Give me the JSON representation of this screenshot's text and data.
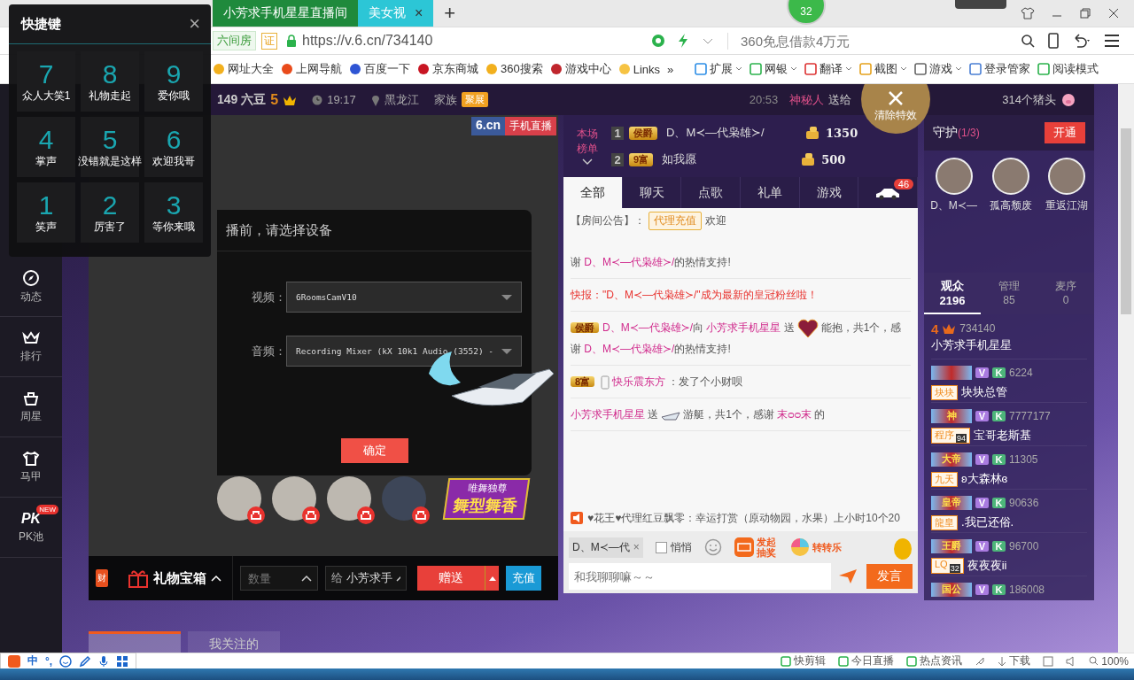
{
  "browser": {
    "tabs": [
      {
        "title": "小芳求手机星星直播间",
        "selected": false
      },
      {
        "title": "美女视",
        "selected": true
      }
    ],
    "tab_close": "×",
    "new_tab": "+",
    "badge": "32",
    "site_label": "六间房",
    "site_badge": "证",
    "url": "https://v.6.cn/734140",
    "search_placeholder": "360免息借款4万元",
    "bookmarks": [
      "网址大全",
      "上网导航",
      "百度一下",
      "京东商城",
      "360搜索",
      "游戏中心",
      "Links"
    ],
    "more": "»",
    "tools": [
      {
        "label": "扩展",
        "dropdown": true
      },
      {
        "label": "网银",
        "dropdown": true
      },
      {
        "label": "翻译",
        "dropdown": true
      },
      {
        "label": "截图",
        "dropdown": true
      },
      {
        "label": "游戏",
        "dropdown": true
      },
      {
        "label": "登录管家",
        "dropdown": false
      },
      {
        "label": "阅读模式",
        "dropdown": false
      }
    ]
  },
  "shortcuts": {
    "title": "快捷键",
    "close": "×",
    "items": [
      {
        "key": "7",
        "label": "众人大笑1"
      },
      {
        "key": "8",
        "label": "礼物走起"
      },
      {
        "key": "9",
        "label": "爱你哦"
      },
      {
        "key": "4",
        "label": "掌声"
      },
      {
        "key": "5",
        "label": "没错就是这样"
      },
      {
        "key": "6",
        "label": "欢迎我哥"
      },
      {
        "key": "1",
        "label": "笑声"
      },
      {
        "key": "2",
        "label": "厉害了"
      },
      {
        "key": "3",
        "label": "等你来哦"
      }
    ]
  },
  "sidebar": [
    {
      "kind": "compass",
      "label": "动态"
    },
    {
      "kind": "crown",
      "label": "排行"
    },
    {
      "kind": "basket",
      "label": "周星"
    },
    {
      "kind": "shirt",
      "label": "马甲"
    },
    {
      "kind": "pk",
      "mark": "PK",
      "label": "PK池",
      "badge": "NEW"
    }
  ],
  "room": {
    "beans": "149 六豆",
    "level_digit": "5",
    "time": "19:17",
    "location": "黑龙江",
    "family_label": "家族",
    "family_badge": "聚展",
    "feed_time": "20:53",
    "feed_sender": "神秘人",
    "feed_verb": "送给",
    "feed_gift": "314个猪头",
    "clear_effects": "清除特效"
  },
  "video": {
    "logo": "6.cn",
    "logo_tag": "手机直播",
    "dialog": {
      "title": "播前，请选择设备",
      "fields": [
        {
          "label": "视频：",
          "value": "6RoomsCamV10"
        },
        {
          "label": "音频：",
          "value": "Recording Mixer (kX 10k1 Audio (3552) -"
        }
      ],
      "confirm": "确定"
    },
    "seats": [
      {
        "kind": "photo"
      },
      {
        "kind": "photo"
      },
      {
        "kind": "photo"
      },
      {
        "kind": "dark"
      }
    ],
    "dance_badge": {
      "title": "舞型舞香",
      "subtitle": "唯舞独尊"
    }
  },
  "gift_bar": {
    "wealth": "财",
    "gift_box": "礼物宝箱",
    "quantity_placeholder": "数量",
    "to_label": "给",
    "to_value": "小芳求手",
    "send": "赠送",
    "recharge": "充值"
  },
  "ranking": {
    "title": "本场榜单",
    "rows": [
      {
        "rank": "1",
        "badge": "侯爵",
        "name": "D、M≺—代枭雄≻/",
        "score": "1350"
      },
      {
        "rank": "2",
        "badge": "9富",
        "name": "如我愿",
        "score": "500"
      }
    ]
  },
  "chat": {
    "tabs": [
      {
        "label": "全部",
        "selected": true
      },
      {
        "label": "聊天",
        "selected": false
      },
      {
        "label": "点歌",
        "selected": false
      },
      {
        "label": "礼单",
        "selected": false
      },
      {
        "label": "游戏",
        "selected": false
      }
    ],
    "car_count": "46",
    "announcement": {
      "label": "【房间公告】：",
      "tag": "代理充值",
      "text": "欢迎"
    },
    "messages": [
      {
        "kind": "normal",
        "segments": [
          {
            "kind": "text",
            "parts": [
              {
                "kind": "plain",
                "text": "谢 "
              },
              {
                "kind": "name",
                "text": "D、M≺—代枭雄≻/"
              },
              {
                "kind": "plain",
                "text": "的热情支持!"
              }
            ]
          }
        ]
      },
      {
        "kind": "alert",
        "segments": [
          {
            "kind": "text",
            "parts": [
              {
                "kind": "plain",
                "text": "快报：\"D、M≺—代枭雄≻/\"成为最新的皇冠粉丝啦！"
              }
            ]
          }
        ]
      },
      {
        "kind": "normal",
        "badge": "侯爵",
        "segments": [
          {
            "kind": "text",
            "parts": [
              {
                "kind": "name",
                "text": "D、M≺—代枭雄≻/"
              },
              {
                "kind": "plain",
                "text": "向 "
              },
              {
                "kind": "name",
                "text": "小芳求手机星星"
              },
              {
                "kind": "plain",
                "text": " 送"
              }
            ]
          },
          {
            "kind": "gift"
          },
          {
            "kind": "text",
            "parts": [
              {
                "kind": "plain",
                "text": "能抱，共1个，感谢 "
              },
              {
                "kind": "name",
                "text": "D、M≺—代枭雄≻/"
              },
              {
                "kind": "plain",
                "text": "的热情支持!"
              }
            ]
          }
        ]
      },
      {
        "kind": "normal",
        "badge": "8富",
        "segments": [
          {
            "kind": "device"
          },
          {
            "kind": "text",
            "parts": [
              {
                "kind": "name",
                "text": "快乐震东方"
              },
              {
                "kind": "plain",
                "text": " ：发了个小财呗"
              }
            ]
          }
        ]
      },
      {
        "kind": "normal",
        "segments": [
          {
            "kind": "text",
            "parts": [
              {
                "kind": "name",
                "text": "小芳求手机星星"
              },
              {
                "kind": "plain",
                "text": " 送"
              }
            ]
          },
          {
            "kind": "gift"
          },
          {
            "kind": "text",
            "parts": [
              {
                "kind": "plain",
                "text": "游艇，共1个，感谢 "
              },
              {
                "kind": "name",
                "text": "末ᴑᴑ末"
              },
              {
                "kind": "plain",
                "text": " 的"
              }
            ]
          }
        ]
      }
    ],
    "notice": "♥花王♥代理红豆飘零：幸运打赏（原动物园，水果）上小时10个20",
    "recipient": "D、M≺—代",
    "recipient_clear": "×",
    "whisper": {
      "label": "悄悄",
      "checked": false
    },
    "lottery": "发起抽奖",
    "wheel": "转转乐",
    "input_placeholder": "和我聊聊嘛～～",
    "send": "发言"
  },
  "guard": {
    "title": "守护",
    "count": "(1/3)",
    "open": "开通",
    "members": [
      "D、M≺—",
      "孤高颓废",
      "重返江湖"
    ]
  },
  "audience": {
    "tabs": [
      {
        "label": "观众",
        "count": "2196",
        "selected": true
      },
      {
        "label": "管理",
        "count": "85",
        "selected": false
      },
      {
        "label": "麦序",
        "count": "0",
        "selected": false
      }
    ],
    "host": {
      "rank_digit": "4",
      "id": "734140",
      "name": "小芳求手机星星"
    },
    "users": [
      {
        "id": "6224",
        "badges": [
          "V",
          "K"
        ],
        "tag": "块块",
        "name": "块块总管"
      },
      {
        "title": "神",
        "id": "7777177",
        "badges": [
          "V",
          "K"
        ],
        "tag": "程序",
        "tag_level": "94",
        "name": "宝哥老斯基"
      },
      {
        "title": "大帝",
        "id": "11305",
        "badges": [
          "V",
          "K"
        ],
        "tag": "九天",
        "name": "ʚ大森林ɞ"
      },
      {
        "title": "皇帝",
        "id": "90636",
        "badges": [
          "V",
          "K"
        ],
        "tag": "龍皇",
        "name": ".我已还俗."
      },
      {
        "title": "王爵",
        "id": "96700",
        "badges": [
          "V",
          "K"
        ],
        "tag": "LQ",
        "tag_level": "32",
        "name": "夜夜夜ii"
      },
      {
        "title": "国公",
        "id": "186008",
        "badges": [
          "V",
          "K"
        ]
      }
    ]
  },
  "bottom_tabs": [
    {
      "selected": true
    },
    {
      "label": "我关注的",
      "selected": false
    }
  ],
  "status": {
    "ime_lang": "中",
    "ime_punct": "°,",
    "items": [
      "快剪辑",
      "今日直播",
      "热点资讯"
    ],
    "download": "下载",
    "zoom": "100%"
  }
}
